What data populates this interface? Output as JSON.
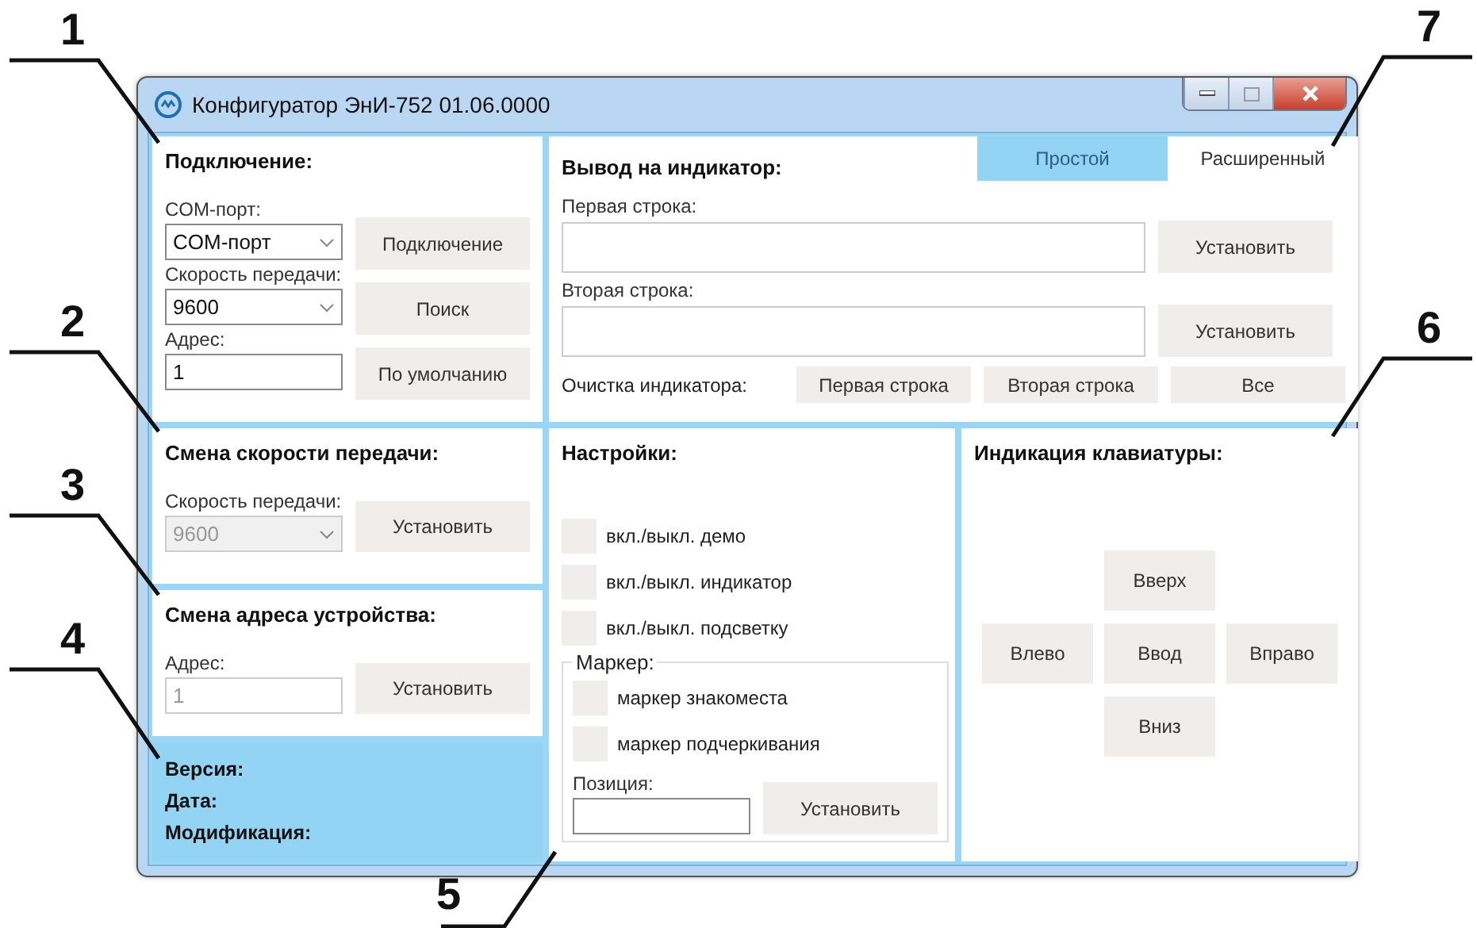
{
  "window": {
    "title": "Конфигуратор ЭнИ-752 01.06.0000"
  },
  "connection": {
    "title": "Подключение:",
    "fields": [
      {
        "label": "COM-порт:",
        "kind": "combo",
        "value": "COM-порт"
      },
      {
        "label": "Скорость передачи:",
        "kind": "combo",
        "value": "9600"
      },
      {
        "label": "Адрес:",
        "kind": "input",
        "value": "1"
      }
    ],
    "buttons": [
      "Подключение",
      "Поиск",
      "По умолчанию"
    ]
  },
  "baud_change": {
    "title": "Смена скорости передачи:",
    "label": "Скорость передачи:",
    "value": "9600",
    "disabled": true,
    "button": "Установить"
  },
  "address_change": {
    "title": "Смена адреса устройства:",
    "label": "Адрес:",
    "value": "1",
    "disabled": true,
    "button": "Установить"
  },
  "info": [
    "Версия:",
    "Дата:",
    "Модификация:"
  ],
  "display": {
    "title": "Вывод на индикатор:",
    "tabs": [
      {
        "label": "Простой",
        "selected": true
      },
      {
        "label": "Расширенный",
        "selected": false
      }
    ],
    "lines": [
      {
        "label": "Первая строка:",
        "button": "Установить"
      },
      {
        "label": "Вторая строка:",
        "button": "Установить"
      }
    ],
    "clear": {
      "label": "Очистка индикатора:",
      "buttons": [
        "Первая строка",
        "Вторая строка",
        "Все"
      ]
    }
  },
  "settings": {
    "title": "Настройки:",
    "toggles": [
      {
        "label": "вкл./выкл. демо",
        "checked": false
      },
      {
        "label": "вкл./выкл. индикатор",
        "checked": false
      },
      {
        "label": "вкл./выкл. подсветку",
        "checked": false
      }
    ],
    "marker": {
      "title": "Маркер:",
      "options": [
        {
          "label": "маркер знакоместа",
          "checked": false
        },
        {
          "label": "маркер подчеркивания",
          "checked": false
        }
      ],
      "position_label": "Позиция:",
      "button": "Установить"
    }
  },
  "keyboard": {
    "title": "Индикация клавиатуры:",
    "key_rows": [
      [
        "Вверх"
      ],
      [
        "Влево",
        "Ввод",
        "Вправо"
      ],
      [
        "Вниз"
      ]
    ]
  },
  "callouts": [
    {
      "number": "1"
    },
    {
      "number": "2"
    },
    {
      "number": "3"
    },
    {
      "number": "4"
    },
    {
      "number": "5"
    },
    {
      "number": "6"
    },
    {
      "number": "7"
    }
  ]
}
